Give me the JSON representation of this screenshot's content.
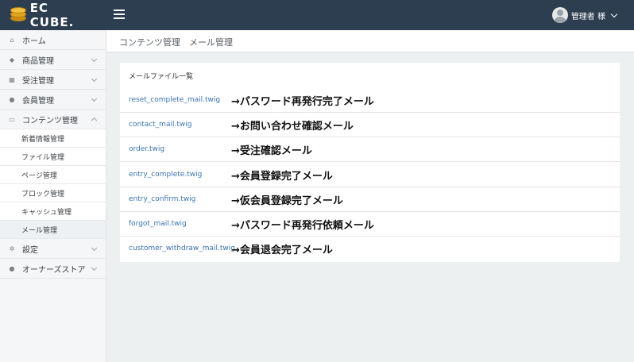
{
  "header": {
    "logo_text": "EC CUBE.",
    "user_name": "管理者 様"
  },
  "sidebar": {
    "items": [
      {
        "icon": "home-icon",
        "glyph": "⌂",
        "label": "ホーム"
      },
      {
        "icon": "tag-icon",
        "glyph": "◆",
        "label": "商品管理"
      },
      {
        "icon": "cart-icon",
        "glyph": "▦",
        "label": "受注管理"
      },
      {
        "icon": "users-icon",
        "glyph": "●",
        "label": "会員管理"
      },
      {
        "icon": "file-icon",
        "glyph": "▭",
        "label": "コンテンツ管理"
      }
    ],
    "sub_items": [
      "新着情報管理",
      "ファイル管理",
      "ページ管理",
      "ブロック管理",
      "キャッシュ管理",
      "メール管理"
    ],
    "bottom_items": [
      {
        "icon": "gear-icon",
        "glyph": "✲",
        "label": "設定"
      },
      {
        "icon": "info-icon",
        "glyph": "●",
        "label": "オーナーズストア"
      }
    ]
  },
  "page": {
    "title": "コンテンツ管理　メール管理"
  },
  "panel": {
    "title": "メールファイル一覧",
    "rows": [
      {
        "file": "reset_complete_mail.twig",
        "note": "→パスワード再発行完了メール"
      },
      {
        "file": "contact_mail.twig",
        "note": "→お問い合わせ確認メール"
      },
      {
        "file": "order.twig",
        "note": "→受注確認メール"
      },
      {
        "file": "entry_complete.twig",
        "note": "→会員登録完了メール"
      },
      {
        "file": "entry_confirm.twig",
        "note": "→仮会員登録完了メール"
      },
      {
        "file": "forgot_mail.twig",
        "note": "→パスワード再発行依頼メール"
      },
      {
        "file": "customer_withdraw_mail.twig",
        "note": "→会員退会完了メール"
      }
    ]
  },
  "colors": {
    "header_bg": "#2c3e50",
    "link": "#3b74b4",
    "page_bg": "#ecf0f1"
  }
}
